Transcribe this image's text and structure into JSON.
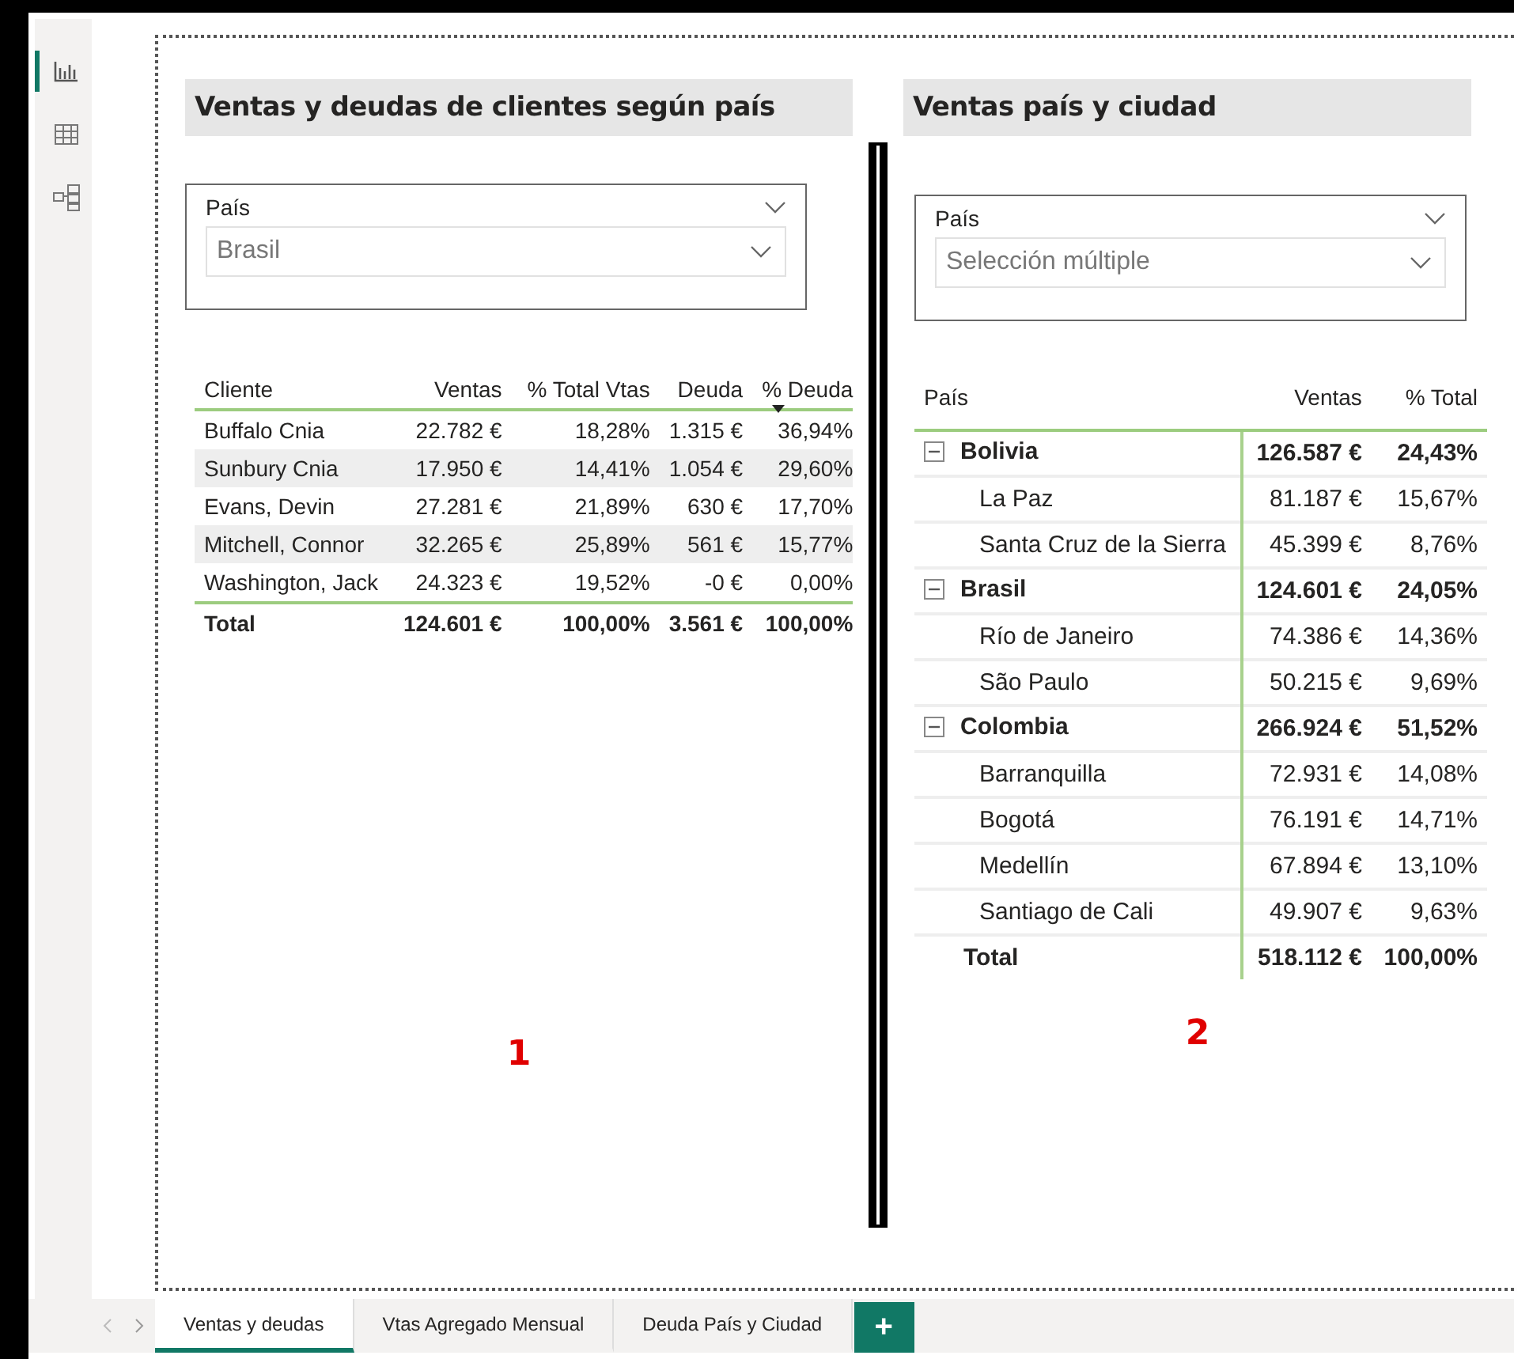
{
  "sidebar": {
    "views": [
      {
        "kind": "report",
        "selected": true
      },
      {
        "kind": "data",
        "selected": false
      },
      {
        "kind": "model",
        "selected": false
      }
    ]
  },
  "visuals": [
    {
      "title": "Ventas y deudas de clientes según país",
      "slicer": {
        "label": "País",
        "value": "Brasil"
      },
      "table": {
        "columns": [
          {
            "label": "Cliente",
            "sorted": false
          },
          {
            "label": "Ventas",
            "sorted": false
          },
          {
            "label": "% Total Vtas",
            "sorted": false
          },
          {
            "label": "Deuda",
            "sorted": false
          },
          {
            "label": "% Deuda",
            "sorted": true
          }
        ],
        "rows": [
          [
            "Buffalo Cnia",
            "22.782 €",
            "18,28%",
            "1.315 €",
            "36,94%"
          ],
          [
            "Sunbury Cnia",
            "17.950 €",
            "14,41%",
            "1.054 €",
            "29,60%"
          ],
          [
            "Evans, Devin",
            "27.281 €",
            "21,89%",
            "630 €",
            "17,70%"
          ],
          [
            "Mitchell, Connor",
            "32.265 €",
            "25,89%",
            "561 €",
            "15,77%"
          ],
          [
            "Washington, Jack",
            "24.323 €",
            "19,52%",
            "-0 €",
            "0,00%"
          ]
        ],
        "total": [
          "Total",
          "124.601 €",
          "100,00%",
          "3.561 €",
          "100,00%"
        ]
      },
      "number": "1"
    },
    {
      "title": "Ventas país y ciudad",
      "slicer": {
        "label": "País",
        "value": "Selección múltiple"
      },
      "matrix": {
        "columns": [
          "País",
          "Ventas",
          "% Total"
        ],
        "rows": [
          {
            "label": "Bolivia",
            "ventas": "126.587 €",
            "total": "24,43%",
            "expanded": true,
            "children": [
              {
                "label": "La Paz",
                "ventas": "81.187 €",
                "total": "15,67%"
              },
              {
                "label": "Santa Cruz de la Sierra",
                "ventas": "45.399 €",
                "total": "8,76%"
              }
            ]
          },
          {
            "label": "Brasil",
            "ventas": "124.601 €",
            "total": "24,05%",
            "expanded": true,
            "children": [
              {
                "label": "Río de Janeiro",
                "ventas": "74.386 €",
                "total": "14,36%"
              },
              {
                "label": "São Paulo",
                "ventas": "50.215 €",
                "total": "9,69%"
              }
            ]
          },
          {
            "label": "Colombia",
            "ventas": "266.924 €",
            "total": "51,52%",
            "expanded": true,
            "children": [
              {
                "label": "Barranquilla",
                "ventas": "72.931 €",
                "total": "14,08%"
              },
              {
                "label": "Bogotá",
                "ventas": "76.191 €",
                "total": "14,71%"
              },
              {
                "label": "Medellín",
                "ventas": "67.894 €",
                "total": "13,10%"
              },
              {
                "label": "Santiago de Cali",
                "ventas": "49.907 €",
                "total": "9,63%"
              }
            ]
          }
        ],
        "total": {
          "label": "Total",
          "ventas": "518.112 €",
          "total": "100,00%"
        }
      },
      "number": "2"
    }
  ],
  "pages": [
    {
      "label": "Ventas y deudas",
      "selected": true
    },
    {
      "label": "Vtas Agregado Mensual",
      "selected": false
    },
    {
      "label": "Deuda País y Ciudad",
      "selected": false
    }
  ],
  "add_page": "+"
}
